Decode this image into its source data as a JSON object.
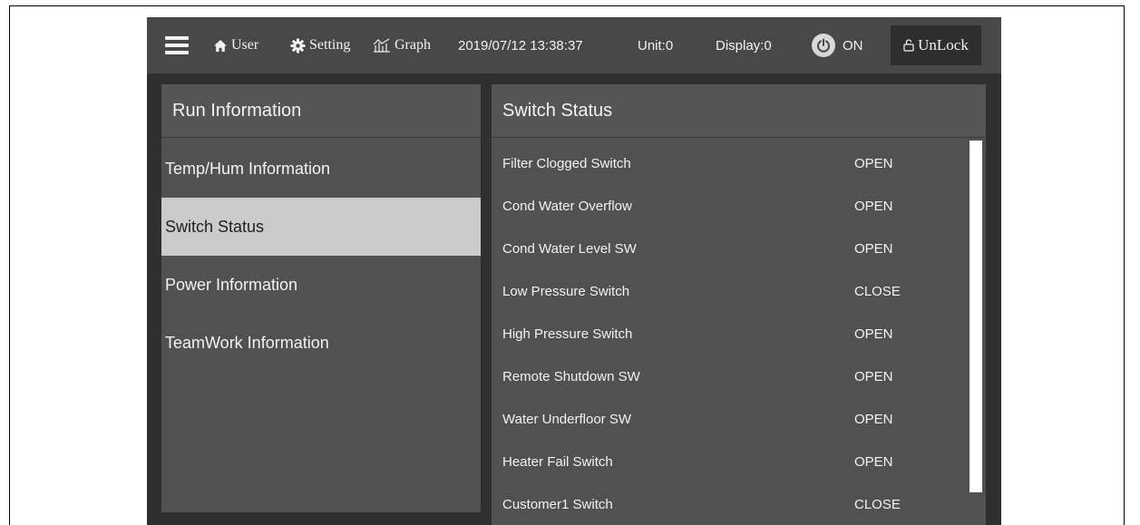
{
  "topbar": {
    "user_label": "User",
    "setting_label": "Setting",
    "graph_label": "Graph",
    "datetime": "2019/07/12 13:38:37",
    "unit": "Unit:0",
    "display": "Display:0",
    "power_label": "ON",
    "unlock_label": "UnLock"
  },
  "left_panel": {
    "title": "Run Information",
    "items": [
      {
        "label": "Temp/Hum Information"
      },
      {
        "label": "Switch Status"
      },
      {
        "label": "Power Information"
      },
      {
        "label": "TeamWork Information"
      }
    ],
    "active_index": 1
  },
  "right_panel": {
    "title": "Switch Status",
    "rows": [
      {
        "name": "Filter Clogged Switch",
        "state": "OPEN"
      },
      {
        "name": "Cond Water Overflow",
        "state": "OPEN"
      },
      {
        "name": "Cond Water Level SW",
        "state": "OPEN"
      },
      {
        "name": "Low Pressure Switch",
        "state": "CLOSE"
      },
      {
        "name": "High Pressure Switch",
        "state": "OPEN"
      },
      {
        "name": "Remote Shutdown SW",
        "state": "OPEN"
      },
      {
        "name": "Water Underfloor SW",
        "state": "OPEN"
      },
      {
        "name": "Heater Fail Switch",
        "state": "OPEN"
      },
      {
        "name": "Customer1 Switch",
        "state": "CLOSE"
      }
    ]
  },
  "icons": {
    "menu": "hamburger-icon",
    "user": "home-icon",
    "setting": "gear-icon",
    "graph": "chart-icon",
    "power": "power-icon",
    "unlock": "unlock-icon"
  },
  "colors": {
    "background": "#2f2f2f",
    "topbar": "#484848",
    "panel": "#515151",
    "active_item": "#cbcbcb",
    "text": "#f2f2f2"
  }
}
